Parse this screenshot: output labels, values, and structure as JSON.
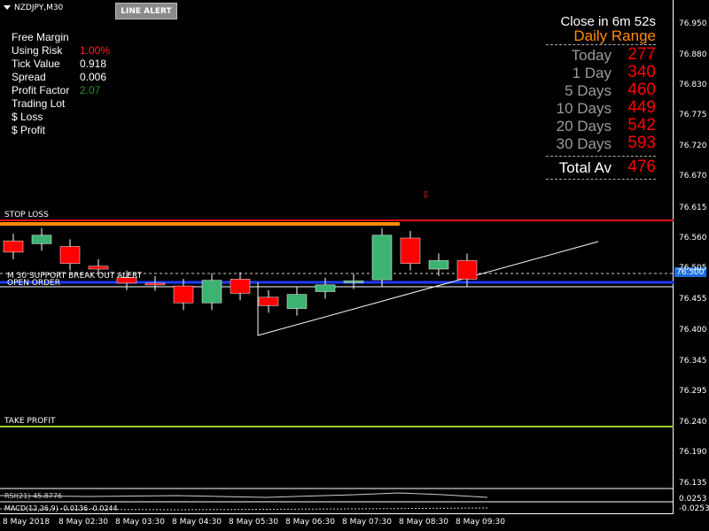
{
  "chart": {
    "symbol": "NZDJPY,M30",
    "alert_button": "LINE ALERT",
    "colors": {
      "bull": "#3cb371",
      "bear": "#ff0000",
      "background": "#000000",
      "support": "#1e3cff",
      "stop_loss": "#e01010",
      "take_profit": "#9acd32"
    }
  },
  "account_panel": {
    "rows": [
      {
        "label": "Free Margin",
        "value": "",
        "color": "#ffffff"
      },
      {
        "label": "Using Risk",
        "value": "1.00%",
        "color": "#ff2020"
      },
      {
        "label": "Tick Value",
        "value": "0.918",
        "color": "#ffffff"
      },
      {
        "label": "Spread",
        "value": "0.006",
        "color": "#ffffff"
      },
      {
        "label": "Profit Factor",
        "value": "2.07",
        "color": "#2e8b2e"
      },
      {
        "label": "Trading Lot",
        "value": "",
        "color": "#ffffff"
      },
      {
        "label": "$ Loss",
        "value": "",
        "color": "#ffffff"
      },
      {
        "label": "$ Profit",
        "value": "",
        "color": "#ffffff"
      }
    ]
  },
  "range_panel": {
    "close_timer": "Close in 6m 52s",
    "title": "Daily Range",
    "rows": [
      {
        "label": "Today",
        "value": "277"
      },
      {
        "label": "1 Day",
        "value": "340"
      },
      {
        "label": "5 Days",
        "value": "460"
      },
      {
        "label": "10 Days",
        "value": "449"
      },
      {
        "label": "20 Days",
        "value": "542"
      },
      {
        "label": "30 Days",
        "value": "593"
      }
    ],
    "total": {
      "label": "Total Av",
      "value": "476"
    }
  },
  "lines": {
    "stop_loss": "STOP LOSS",
    "take_profit": "TAKE PROFIT",
    "support_alert": "M 30 SUPPORT BREAK OUT ALERT",
    "open_order": "OPEN ORDER",
    "current_price": "76.500"
  },
  "y_axis": [
    "76.950",
    "76.880",
    "76.830",
    "76.775",
    "76.720",
    "76.670",
    "76.615",
    "76.560",
    "76.505",
    "76.455",
    "76.400",
    "76.345",
    "76.295",
    "76.240",
    "76.190",
    "76.135",
    "0.0253",
    "-0.0253"
  ],
  "x_axis": [
    "8 May 2018",
    "8 May 02:30",
    "8 May 03:30",
    "8 May 04:30",
    "8 May 05:30",
    "8 May 06:30",
    "8 May 07:30",
    "8 May 08:30",
    "8 May 09:30"
  ],
  "indicators": {
    "rsi": "RSI(21) 45.8776",
    "macd": "MACD(12,26,9) -0.0136 -0.0244"
  },
  "candles": [
    {
      "o": 76.565,
      "c": 76.545
    },
    {
      "o": 76.56,
      "c": 76.575
    },
    {
      "o": 76.555,
      "c": 76.525
    },
    {
      "o": 76.52,
      "c": 76.515
    },
    {
      "o": 76.5,
      "c": 76.49
    },
    {
      "o": 76.49,
      "c": 76.489
    },
    {
      "o": 76.485,
      "c": 76.455
    },
    {
      "o": 76.455,
      "c": 76.495
    },
    {
      "o": 76.497,
      "c": 76.472
    },
    {
      "o": 76.465,
      "c": 76.45
    },
    {
      "o": 76.445,
      "c": 76.47
    },
    {
      "o": 76.475,
      "c": 76.487
    },
    {
      "o": 76.492,
      "c": 76.494
    },
    {
      "o": 76.496,
      "c": 76.575
    },
    {
      "o": 76.57,
      "c": 76.525
    },
    {
      "o": 76.515,
      "c": 76.53
    },
    {
      "o": 76.53,
      "c": 76.497
    }
  ]
}
